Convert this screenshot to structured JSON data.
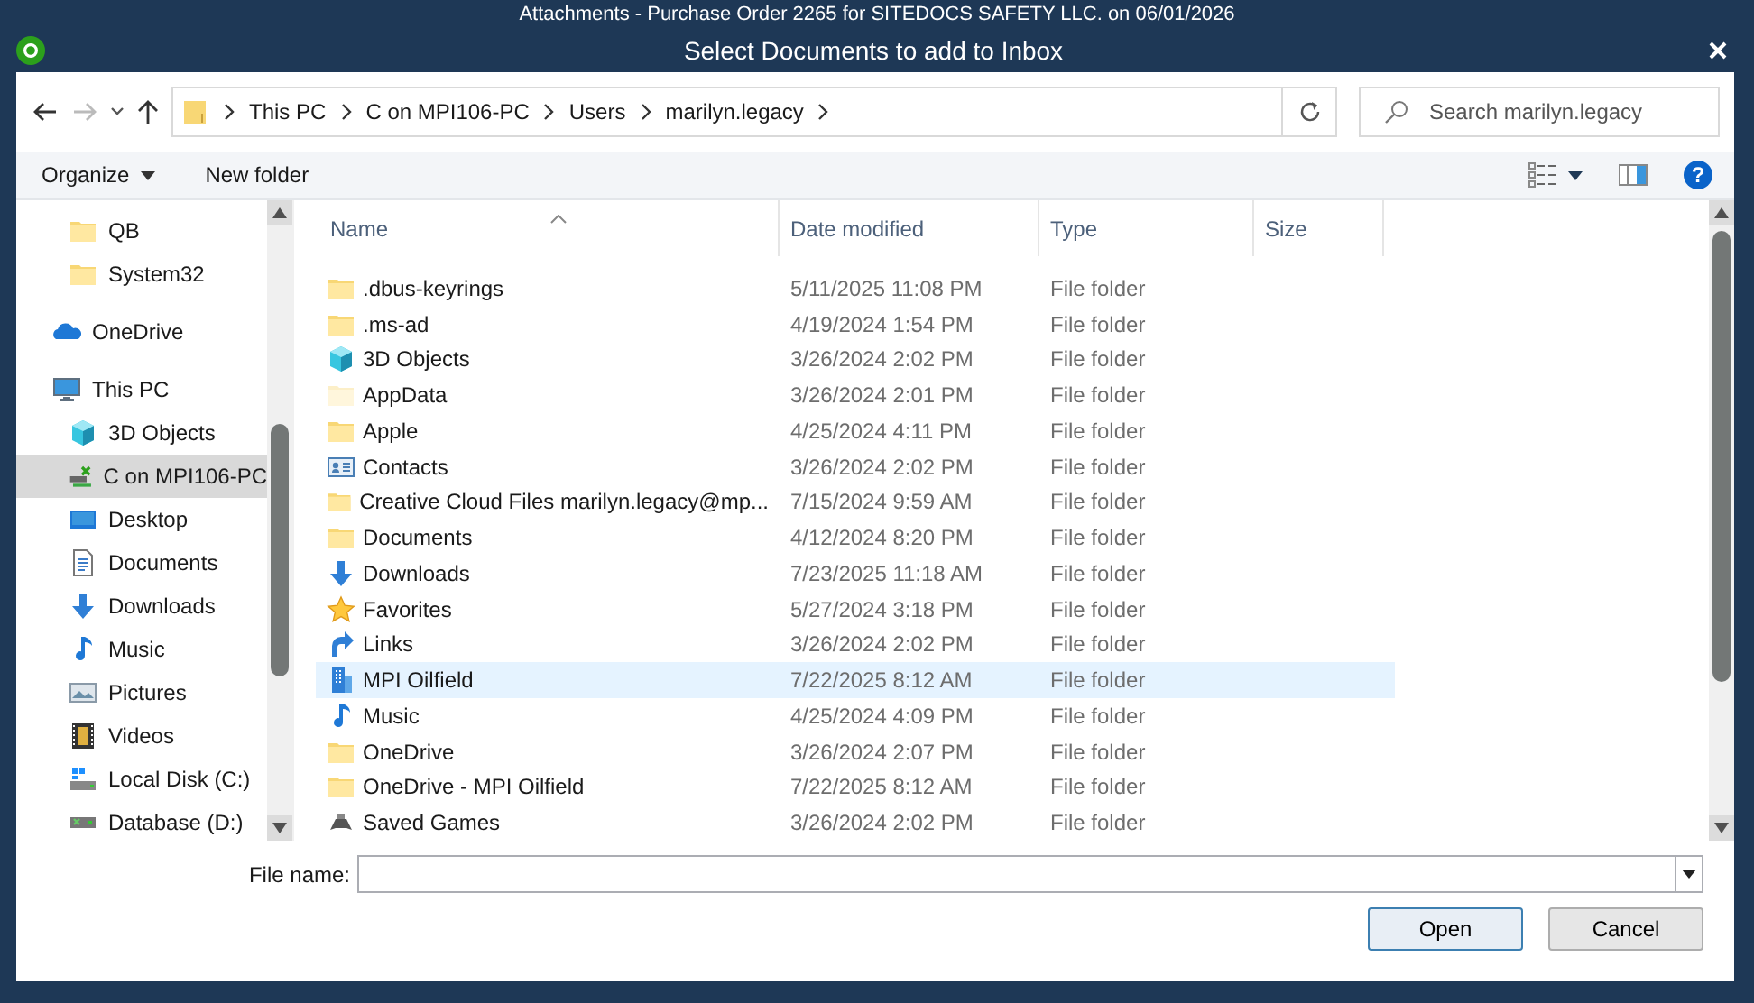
{
  "background_window": {
    "title": "Attachments - Purchase Order 2265 for SITEDOCS SAFETY LLC. on 06/01/2026"
  },
  "dialog": {
    "title": "Select Documents to add to Inbox"
  },
  "address_bar": {
    "path": [
      "This PC",
      "C on MPI106-PC",
      "Users",
      "marilyn.legacy"
    ]
  },
  "search": {
    "placeholder": "Search marilyn.legacy"
  },
  "toolbar": {
    "organize": "Organize",
    "new_folder": "New folder",
    "help": "?"
  },
  "sidebar": {
    "partial_children": [
      {
        "label": "QB",
        "kind": "folder",
        "selected": false
      },
      {
        "label": "System32",
        "kind": "folder",
        "selected": false
      }
    ],
    "items": [
      {
        "label": "OneDrive",
        "kind": "cloud",
        "selected": false
      },
      {
        "label": "This PC",
        "kind": "computer",
        "selected": false,
        "children": [
          {
            "label": "3D Objects",
            "kind": "cube",
            "selected": false
          },
          {
            "label": "C on MPI106-PC",
            "kind": "netdrive",
            "selected": true
          },
          {
            "label": "Desktop",
            "kind": "desktop",
            "selected": false
          },
          {
            "label": "Documents",
            "kind": "document",
            "selected": false
          },
          {
            "label": "Downloads",
            "kind": "download",
            "selected": false
          },
          {
            "label": "Music",
            "kind": "music",
            "selected": false
          },
          {
            "label": "Pictures",
            "kind": "picture",
            "selected": false
          },
          {
            "label": "Videos",
            "kind": "video",
            "selected": false
          },
          {
            "label": "Local Disk (C:)",
            "kind": "disk",
            "selected": false
          },
          {
            "label": "Database (D:)",
            "kind": "netdisk",
            "selected": false
          }
        ]
      }
    ]
  },
  "table": {
    "columns": [
      {
        "label": "Name",
        "sorted": true
      },
      {
        "label": "Date modified",
        "sorted": false
      },
      {
        "label": "Type",
        "sorted": false
      },
      {
        "label": "Size",
        "sorted": false
      }
    ],
    "rows": [
      {
        "name": ".dbus-keyrings",
        "date": "5/11/2025 11:08 PM",
        "type": "File folder",
        "kind": "folder",
        "selected": false
      },
      {
        "name": ".ms-ad",
        "date": "4/19/2024 1:54 PM",
        "type": "File folder",
        "kind": "folder",
        "selected": false
      },
      {
        "name": "3D Objects",
        "date": "3/26/2024 2:02 PM",
        "type": "File folder",
        "kind": "cube",
        "selected": false
      },
      {
        "name": "AppData",
        "date": "3/26/2024 2:01 PM",
        "type": "File folder",
        "kind": "hidden",
        "selected": false
      },
      {
        "name": "Apple",
        "date": "4/25/2024 4:11 PM",
        "type": "File folder",
        "kind": "folder",
        "selected": false
      },
      {
        "name": "Contacts",
        "date": "3/26/2024 2:02 PM",
        "type": "File folder",
        "kind": "contacts",
        "selected": false
      },
      {
        "name": "Creative Cloud Files  marilyn.legacy@mp...",
        "date": "7/15/2024 9:59 AM",
        "type": "File folder",
        "kind": "folder",
        "selected": false
      },
      {
        "name": "Documents",
        "date": "4/12/2024 8:20 PM",
        "type": "File folder",
        "kind": "folder",
        "selected": false
      },
      {
        "name": "Downloads",
        "date": "7/23/2025 11:18 AM",
        "type": "File folder",
        "kind": "download",
        "selected": false
      },
      {
        "name": "Favorites",
        "date": "5/27/2024 3:18 PM",
        "type": "File folder",
        "kind": "star",
        "selected": false
      },
      {
        "name": "Links",
        "date": "3/26/2024 2:02 PM",
        "type": "File folder",
        "kind": "link",
        "selected": false
      },
      {
        "name": "MPI Oilfield",
        "date": "7/22/2025 8:12 AM",
        "type": "File folder",
        "kind": "building",
        "selected": true
      },
      {
        "name": "Music",
        "date": "4/25/2024 4:09 PM",
        "type": "File folder",
        "kind": "music",
        "selected": false
      },
      {
        "name": "OneDrive",
        "date": "3/26/2024 2:07 PM",
        "type": "File folder",
        "kind": "folder",
        "selected": false
      },
      {
        "name": "OneDrive - MPI Oilfield",
        "date": "7/22/2025 8:12 AM",
        "type": "File folder",
        "kind": "folder",
        "selected": false
      },
      {
        "name": "Saved Games",
        "date": "3/26/2024 2:02 PM",
        "type": "File folder",
        "kind": "games",
        "selected": false
      }
    ]
  },
  "file_name": {
    "label": "File name:"
  },
  "buttons": [
    {
      "label": "Open",
      "default": true
    },
    {
      "label": "Cancel",
      "default": false
    }
  ]
}
